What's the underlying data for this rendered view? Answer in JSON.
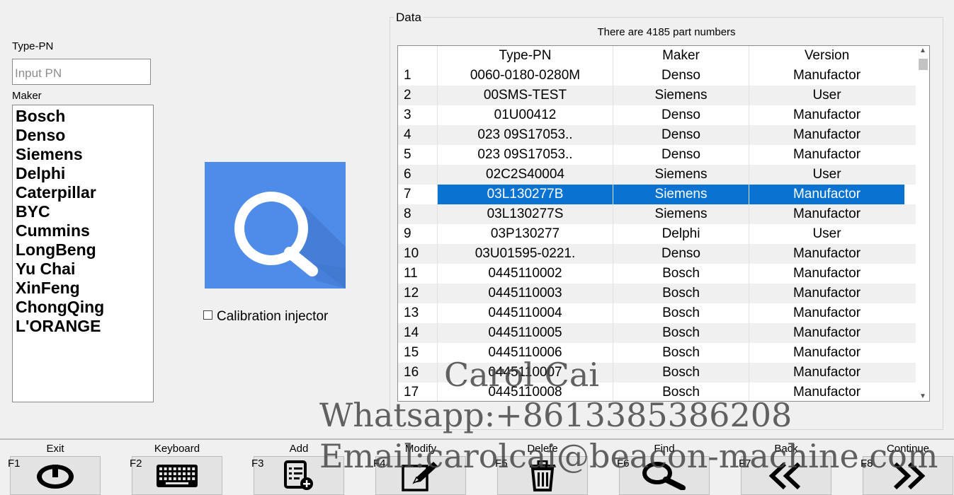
{
  "left_panel": {
    "type_pn_label": "Type-PN",
    "pn_input_placeholder": "Input PN",
    "pn_input_value": "",
    "maker_label": "Maker",
    "makers": [
      "Bosch",
      "Denso",
      "Siemens",
      "Delphi",
      "Caterpillar",
      "BYC",
      "Cummins",
      "LongBeng",
      "Yu Chai",
      "XinFeng",
      "ChongQing",
      "L'ORANGE"
    ]
  },
  "center": {
    "search_icon": "magnifier-icon",
    "calibration_label": "Calibration injector",
    "calibration_checked": false
  },
  "data_panel": {
    "title": "Data",
    "count_text": "There are 4185 part numbers",
    "columns": [
      "Type-PN",
      "Maker",
      "Version"
    ],
    "rows": [
      [
        "1",
        "0060-0180-0280M",
        "Denso",
        "Manufactor"
      ],
      [
        "2",
        "00SMS-TEST",
        "Siemens",
        "User"
      ],
      [
        "3",
        "01U00412",
        "Denso",
        "Manufactor"
      ],
      [
        "4",
        "023 09S17053..",
        "Denso",
        "Manufactor"
      ],
      [
        "5",
        "023 09S17053..",
        "Denso",
        "Manufactor"
      ],
      [
        "6",
        "02C2S40004",
        "Siemens",
        "User"
      ],
      [
        "7",
        "03L130277B",
        "Siemens",
        "Manufactor"
      ],
      [
        "8",
        "03L130277S",
        "Siemens",
        "Manufactor"
      ],
      [
        "9",
        "03P130277",
        "Delphi",
        "User"
      ],
      [
        "10",
        "03U01595-0221.",
        "Denso",
        "Manufactor"
      ],
      [
        "11",
        "0445110002",
        "Bosch",
        "Manufactor"
      ],
      [
        "12",
        "0445110003",
        "Bosch",
        "Manufactor"
      ],
      [
        "13",
        "0445110004",
        "Bosch",
        "Manufactor"
      ],
      [
        "14",
        "0445110005",
        "Bosch",
        "Manufactor"
      ],
      [
        "15",
        "0445110006",
        "Bosch",
        "Manufactor"
      ],
      [
        "16",
        "0445110007",
        "Bosch",
        "Manufactor"
      ],
      [
        "17",
        "0445110008",
        "Bosch",
        "Manufactor"
      ]
    ],
    "selected_row": "7",
    "selection_color": "#0a72d1"
  },
  "toolbar": [
    {
      "key": "F1",
      "label": "Exit",
      "icon": "power-icon"
    },
    {
      "key": "F2",
      "label": "Keyboard",
      "icon": "keyboard-icon"
    },
    {
      "key": "F3",
      "label": "Add",
      "icon": "add-list-icon"
    },
    {
      "key": "F4",
      "label": "Modify",
      "icon": "edit-icon"
    },
    {
      "key": "F5",
      "label": "Delete",
      "icon": "trash-icon"
    },
    {
      "key": "F6",
      "label": "Find",
      "icon": "search-icon"
    },
    {
      "key": "F7",
      "label": "Back",
      "icon": "double-chevron-left-icon"
    },
    {
      "key": "F8",
      "label": "Continue",
      "icon": "double-chevron-right-icon"
    }
  ],
  "watermark": {
    "name": "Carol Cai",
    "phone": "Whatsapp:+8613385386208",
    "email": "Email:carolcai@beacon-machine.com"
  },
  "accent_color": "#4f8be8"
}
